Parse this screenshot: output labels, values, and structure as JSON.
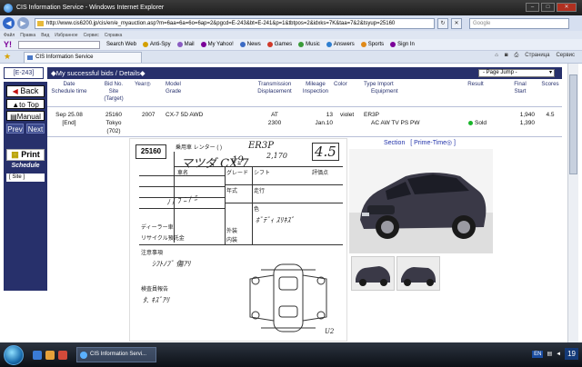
{
  "browser": {
    "window_title": "CIS Information Service - Windows Internet Explorer",
    "url": "http://www.cis6200.jp/cis/en/e_myauction.asp?m=6aa=6a=6o=6ap=2&pgcd=E-243&bt=E-241&p=1&tbtpos=2&idxks=7K&taa=7&2&tsyup=25160",
    "search_placeholder": "Google",
    "menu_items": [
      "Файл",
      "Правка",
      "Вид",
      "Избранное",
      "Сервис",
      "Справка"
    ],
    "toolbar_items": [
      "Search Web",
      "Anti-Spy",
      "Mail",
      "My Yahoo!",
      "News",
      "Games",
      "Music",
      "Answers",
      "Sports",
      "Sign In"
    ],
    "yahoo_label": "Y!",
    "tab_label": "CIS Information Service",
    "tab_tools": [
      "Страница",
      "Сервис"
    ]
  },
  "page": {
    "code_label": "[E-243]",
    "header_title": "◆My successful bids / Details◆",
    "jump_label": "- Page Jump -",
    "sidebar": {
      "back": "Back",
      "to_top": "to Top",
      "manual": "Manual",
      "prev": "Prev",
      "next": "Next",
      "print": "Print",
      "schedule": "Schedule",
      "site": "[ Site ]"
    },
    "columns": {
      "date": "Date",
      "schedule_time": "Schedule time",
      "bid_no": "Bid No.",
      "site": "Site",
      "target": "(Target)",
      "year": "Year◎",
      "model": "Model",
      "grade": "Grade",
      "transmission": "Transmission",
      "displacement": "Displacement",
      "mileage": "Mileage",
      "inspection": "Inspection",
      "color": "Color",
      "type_import": "Type  Import",
      "equipment": "Equipment",
      "result": "Result",
      "final": "Final",
      "start": "Start",
      "scores": "Scores"
    },
    "row": {
      "date": "Sep 25.08",
      "end": "[End]",
      "bid_no": "25160",
      "site": "Tokyo",
      "target": "(702)",
      "year": "2007",
      "model": "CX-7 5D AWD",
      "transmission": "AT",
      "displacement": "2300",
      "mileage": "13",
      "inspection": "Jan.10",
      "color": "violet",
      "type": "ER3P",
      "equipment": "AC AW TV PS PW",
      "result": "Sold",
      "final": "1,940",
      "start": "1,390",
      "score": "4.5"
    },
    "links": {
      "section": "Section",
      "prime_time": "[ Prime-Time◎ ]"
    },
    "sheet": {
      "lot": "25160",
      "model_hand": "ER3P",
      "name_hand": "マツダ CX-7",
      "year_hand": "19",
      "score_hand": "4.5",
      "notes_hand": "ｼﾌﾄﾉﾌﾞ 傷ｱﾘ",
      "inspector_hand": "ﾀ. ｷｽﾞｱﾘ",
      "mileage_hand": "2,170",
      "code_hand": "U2",
      "title_line": "乗用車 レンター ( )",
      "labels": [
        "車名",
        "グレード",
        "年式",
        "シフト",
        "走行",
        "評価点",
        "色",
        "注意事項",
        "検査員報告",
        "リサイクル預託金",
        "ディーラー車",
        "外装",
        "内装"
      ]
    }
  },
  "taskbar": {
    "task_label": "CIS Information Servi...",
    "lang": "EN",
    "clock": "19"
  },
  "colors": {
    "navy": "#27306b",
    "link": "#2233aa",
    "sold": "#19b52a"
  }
}
